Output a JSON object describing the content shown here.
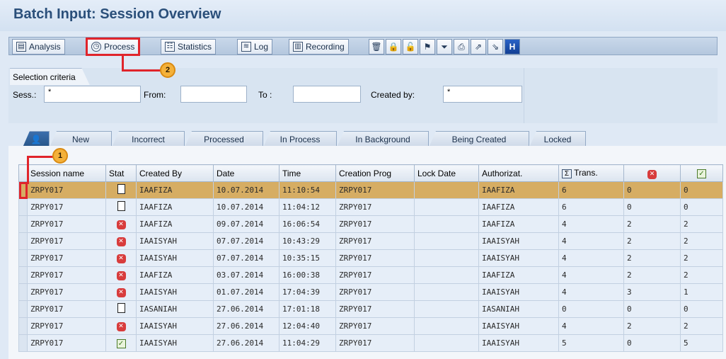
{
  "title": "Batch Input: Session Overview",
  "toolbar": {
    "analysis": "Analysis",
    "process": "Process",
    "statistics": "Statistics",
    "log": "Log",
    "recording": "Recording"
  },
  "selection": {
    "tab_label": "Selection criteria",
    "sess_label": "Sess.:",
    "sess_value": "*",
    "from_label": "From:",
    "from_value": "",
    "to_label": "To :",
    "to_value": "",
    "created_by_label": "Created by:",
    "created_by_value": "*"
  },
  "tabs": [
    "New",
    "Incorrect",
    "Processed",
    "In Process",
    "In Background",
    "Being Created",
    "Locked"
  ],
  "columns": [
    "Session name",
    "Stat",
    "Created By",
    "Date",
    "Time",
    "Creation Prog",
    "Lock Date",
    "Authorizat.",
    "Trans.",
    "",
    ""
  ],
  "rows": [
    {
      "name": "ZRPY017",
      "stat": "new",
      "created_by": "IAAFIZA",
      "date": "10.07.2014",
      "time": "11:10:54",
      "prog": "ZRPY017",
      "lock": "",
      "auth": "IAAFIZA",
      "trans": "6",
      "err": "0",
      "ok": "0"
    },
    {
      "name": "ZRPY017",
      "stat": "new",
      "created_by": "IAAFIZA",
      "date": "10.07.2014",
      "time": "11:04:12",
      "prog": "ZRPY017",
      "lock": "",
      "auth": "IAAFIZA",
      "trans": "6",
      "err": "0",
      "ok": "0"
    },
    {
      "name": "ZRPY017",
      "stat": "error",
      "created_by": "IAAFIZA",
      "date": "09.07.2014",
      "time": "16:06:54",
      "prog": "ZRPY017",
      "lock": "",
      "auth": "IAAFIZA",
      "trans": "4",
      "err": "2",
      "ok": "2"
    },
    {
      "name": "ZRPY017",
      "stat": "error",
      "created_by": "IAAISYAH",
      "date": "07.07.2014",
      "time": "10:43:29",
      "prog": "ZRPY017",
      "lock": "",
      "auth": "IAAISYAH",
      "trans": "4",
      "err": "2",
      "ok": "2"
    },
    {
      "name": "ZRPY017",
      "stat": "error",
      "created_by": "IAAISYAH",
      "date": "07.07.2014",
      "time": "10:35:15",
      "prog": "ZRPY017",
      "lock": "",
      "auth": "IAAISYAH",
      "trans": "4",
      "err": "2",
      "ok": "2"
    },
    {
      "name": "ZRPY017",
      "stat": "error",
      "created_by": "IAAFIZA",
      "date": "03.07.2014",
      "time": "16:00:38",
      "prog": "ZRPY017",
      "lock": "",
      "auth": "IAAFIZA",
      "trans": "4",
      "err": "2",
      "ok": "2"
    },
    {
      "name": "ZRPY017",
      "stat": "error",
      "created_by": "IAAISYAH",
      "date": "01.07.2014",
      "time": "17:04:39",
      "prog": "ZRPY017",
      "lock": "",
      "auth": "IAAISYAH",
      "trans": "4",
      "err": "3",
      "ok": "1"
    },
    {
      "name": "ZRPY017",
      "stat": "new",
      "created_by": "IASANIAH",
      "date": "27.06.2014",
      "time": "17:01:18",
      "prog": "ZRPY017",
      "lock": "",
      "auth": "IASANIAH",
      "trans": "0",
      "err": "0",
      "ok": "0"
    },
    {
      "name": "ZRPY017",
      "stat": "error",
      "created_by": "IAAISYAH",
      "date": "27.06.2014",
      "time": "12:04:40",
      "prog": "ZRPY017",
      "lock": "",
      "auth": "IAAISYAH",
      "trans": "4",
      "err": "2",
      "ok": "2"
    },
    {
      "name": "ZRPY017",
      "stat": "processed",
      "created_by": "IAAISYAH",
      "date": "27.06.2014",
      "time": "11:04:29",
      "prog": "ZRPY017",
      "lock": "",
      "auth": "IAAISYAH",
      "trans": "5",
      "err": "0",
      "ok": "5"
    }
  ],
  "callouts": [
    "1",
    "2"
  ],
  "colors": {
    "highlight_row": "#d6ad63",
    "callout_red": "#e0242b",
    "title": "#2a4f7a"
  }
}
